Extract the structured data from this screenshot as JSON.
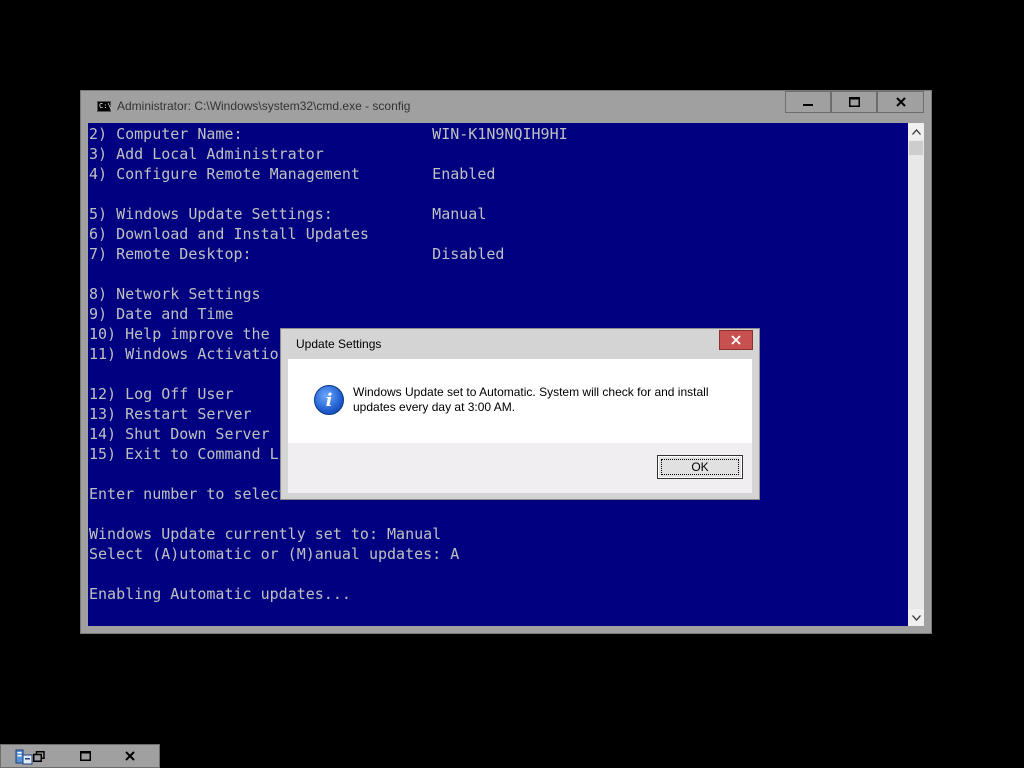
{
  "cmd": {
    "title": "Administrator: C:\\Windows\\system32\\cmd.exe - sconfig",
    "icon_label": "C:\\",
    "controls": {
      "minimize": "▬",
      "maximize": "❐",
      "close": "✕"
    },
    "lines": [
      "2) Computer Name:                     WIN-K1N9NQIH9HI",
      "3) Add Local Administrator",
      "4) Configure Remote Management        Enabled",
      "",
      "5) Windows Update Settings:           Manual",
      "6) Download and Install Updates",
      "7) Remote Desktop:                    Disabled",
      "",
      "8) Network Settings",
      "9) Date and Time",
      "10) Help improve the p",
      "11) Windows Activation",
      "",
      "12) Log Off User",
      "13) Restart Server",
      "14) Shut Down Server",
      "15) Exit to Command Li",
      "",
      "Enter number to select",
      "",
      "Windows Update currently set to: Manual",
      "Select (A)utomatic or (M)anual updates: A",
      "",
      "Enabling Automatic updates..."
    ],
    "colors": {
      "background": "#000080",
      "text": "#c0c0c0",
      "frame": "#a0a0a0"
    }
  },
  "dialog": {
    "title": "Update Settings",
    "close_label": "✕",
    "message": "Windows Update set to Automatic.  System will check for and install updates every day at 3:00 AM.",
    "icon": "information-icon",
    "ok_label": "OK"
  },
  "minimized_window": {
    "icon": "server-manager-icon",
    "restore_label": "❐",
    "maximize_label": "□",
    "close_label": "✕"
  }
}
